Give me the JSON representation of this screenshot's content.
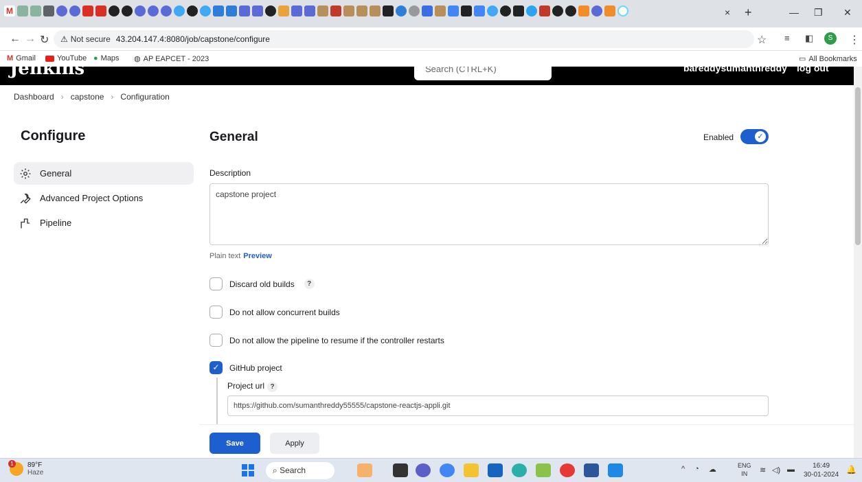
{
  "browser": {
    "tab_close": "×",
    "new_tab": "+",
    "security_label": "Not secure",
    "url": "43.204.147.4:8080/job/capstone/configure",
    "bookmarks": [
      "Gmail",
      "YouTube",
      "Maps",
      "AP EAPCET - 2023"
    ],
    "all_bookmarks": "All Bookmarks",
    "profile_initial": "S"
  },
  "jenkins_header": {
    "logo": "Jenkins",
    "search_placeholder": "Search (CTRL+K)",
    "user": "bareddysumanthreddy",
    "logout": "log out"
  },
  "breadcrumb": [
    "Dashboard",
    "capstone",
    "Configuration"
  ],
  "sidebar": {
    "title": "Configure",
    "items": [
      {
        "label": "General",
        "icon": "gear-icon"
      },
      {
        "label": "Advanced Project Options",
        "icon": "wrench-icon"
      },
      {
        "label": "Pipeline",
        "icon": "pipeline-icon"
      }
    ]
  },
  "general": {
    "title": "General",
    "enabled_label": "Enabled",
    "enabled": true,
    "description_label": "Description",
    "description_value": "capstone project",
    "plain_text": "Plain text",
    "preview": "Preview",
    "options": [
      {
        "label": "Discard old builds",
        "checked": false,
        "help": true
      },
      {
        "label": "Do not allow concurrent builds",
        "checked": false,
        "help": false
      },
      {
        "label": "Do not allow the pipeline to resume if the controller restarts",
        "checked": false,
        "help": false
      },
      {
        "label": "GitHub project",
        "checked": true,
        "help": false
      }
    ],
    "help_glyph": "?",
    "project_url_label": "Project url",
    "project_url_value": "https://github.com/sumanthreddy55555/capstone-reactjs-appli.git"
  },
  "actions": {
    "save": "Save",
    "apply": "Apply"
  },
  "taskbar": {
    "weather_badge": "1",
    "temperature": "89°F",
    "condition": "Haze",
    "search": "Search",
    "lang_1": "ENG",
    "lang_2": "IN",
    "time": "16:49",
    "date": "30-01-2024"
  }
}
